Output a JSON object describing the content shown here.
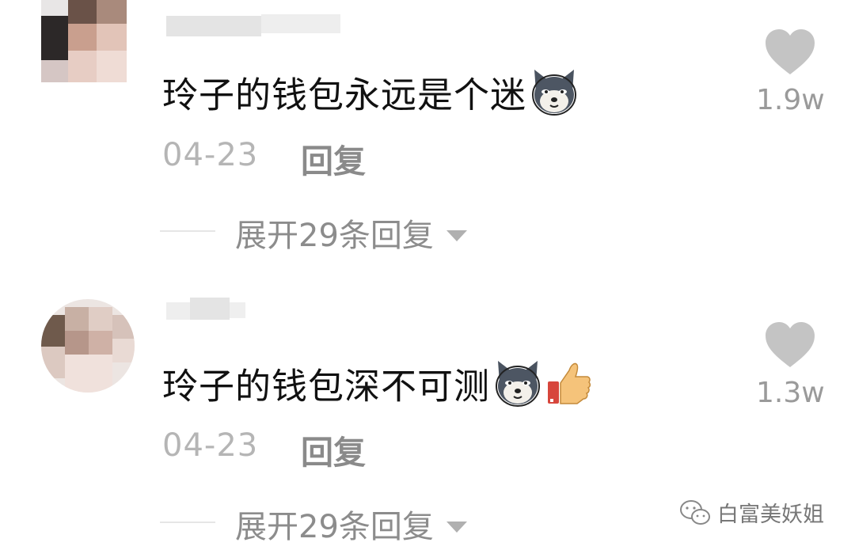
{
  "comments": [
    {
      "text": "玲子的钱包永远是个迷",
      "emojis": [
        "husky-dog-emoji"
      ],
      "date": "04-23",
      "reply_label": "回复",
      "expand_label": "展开29条回复",
      "like_count": "1.9w"
    },
    {
      "text": "玲子的钱包深不可测",
      "emojis": [
        "husky-dog-emoji",
        "thumbs-up-emoji"
      ],
      "date": "04-23",
      "reply_label": "回复",
      "expand_label": "展开29条回复",
      "like_count": "1.3w"
    }
  ],
  "watermark": {
    "text": "白富美妖姐",
    "icon": "wechat-icon"
  },
  "colors": {
    "text": "#111111",
    "meta": "#b5b5b5",
    "reply": "#8a8a8a",
    "heart": "#c4c4c4"
  }
}
